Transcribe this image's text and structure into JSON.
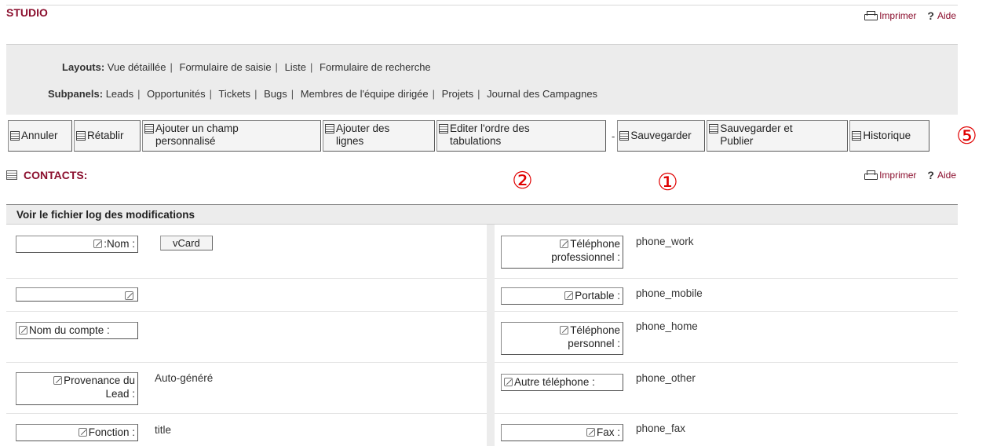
{
  "header": {
    "title": "STUDIO",
    "print_label": "Imprimer",
    "help_label": "Aide"
  },
  "layouts": {
    "label": "Layouts:",
    "items": [
      "Vue détaillée",
      "Formulaire de saisie",
      "Liste",
      "Formulaire de recherche"
    ]
  },
  "subpanels": {
    "label": "Subpanels:",
    "items": [
      "Leads",
      "Opportunités",
      "Tickets",
      "Bugs",
      "Membres de l'équipe dirigée",
      "Projets",
      "Journal des Campagnes"
    ]
  },
  "toolbar": {
    "cancel": "Annuler",
    "redo": "Rétablir",
    "add_field_1": "Ajouter un champ",
    "add_field_2": "personnalisé",
    "add_rows_1": "Ajouter des",
    "add_rows_2": "lignes",
    "edit_tab_order_1": "Editer l'ordre des",
    "edit_tab_order_2": "tabulations",
    "separator": "-",
    "save": "Sauvegarder",
    "save_publish_1": "Sauvegarder et",
    "save_publish_2": "Publier",
    "history": "Historique"
  },
  "annotations": {
    "one": "①",
    "two": "②",
    "five": "⑤"
  },
  "module": {
    "title": "CONTACTS:",
    "print_label": "Imprimer",
    "help_label": "Aide"
  },
  "log_header": "Voir le fichier log des modifications",
  "fields": {
    "nom_label": ":Nom :",
    "vcard": "vCard",
    "tel_pro_1": "Téléphone",
    "tel_pro_2": "professionnel :",
    "tel_pro_value": "phone_work",
    "portable_label": "Portable :",
    "portable_value": "phone_mobile",
    "compte_label": "Nom du compte :",
    "tel_perso_1": "Téléphone",
    "tel_perso_2": "personnel :",
    "tel_perso_value": "phone_home",
    "provenance_1": "Provenance du",
    "provenance_2": "Lead :",
    "provenance_value": "Auto-généré",
    "autre_tel_label": "Autre téléphone :",
    "autre_tel_value": "phone_other",
    "fonction_label": "Fonction :",
    "fonction_value": "title",
    "fax_label": "Fax :",
    "fax_value": "phone_fax"
  },
  "colors": {
    "brand": "#8b0f2e",
    "annotation": "#e00000",
    "panel_bg": "#ececec"
  }
}
